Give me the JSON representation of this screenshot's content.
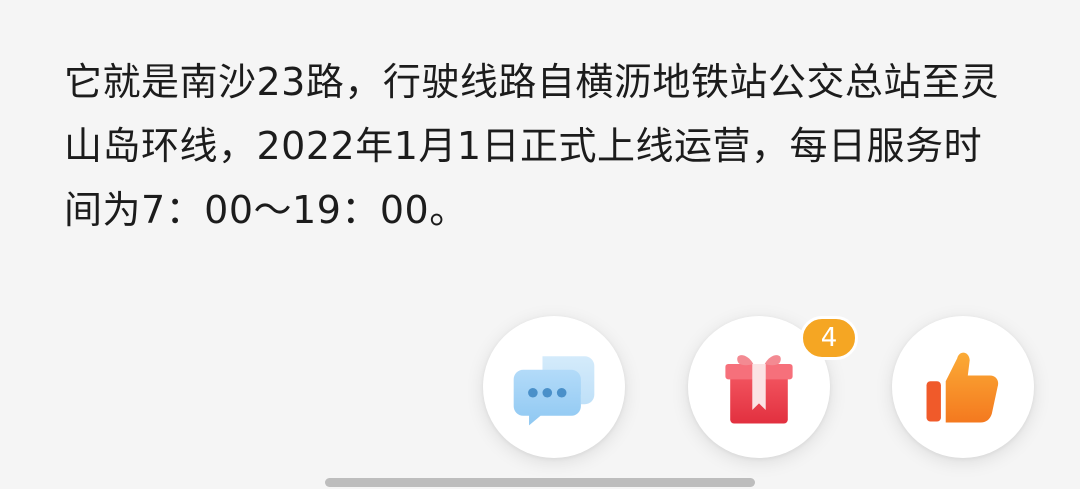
{
  "post": {
    "text": "它就是南沙23路，行驶线路自横沥地铁站公交总站至灵山岛环线，2022年1月1日正式上线运营，每日服务时间为7：00～19：00。"
  },
  "actions": {
    "comment": {
      "icon": "chat-bubbles-icon"
    },
    "gift": {
      "icon": "gift-box-icon",
      "badge": "4"
    },
    "like": {
      "icon": "thumbs-up-icon"
    }
  },
  "colors": {
    "background": "#f5f5f5",
    "text": "#1c1c1c",
    "badge": "#f5a623",
    "comment_icon": "#9fd0f5",
    "gift_icon": "#ee3f4d",
    "like_icon": "#f7922a"
  }
}
